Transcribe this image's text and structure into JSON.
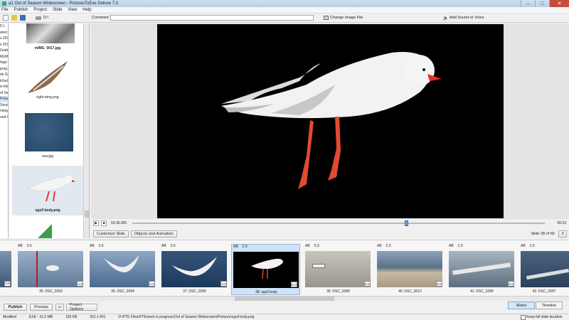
{
  "window": {
    "title": "a1 Out of Season Widescreen - PicturesToExe Deluxe 7.0"
  },
  "menu": [
    "File",
    "Publish",
    "Project",
    "Slide",
    "View",
    "Help"
  ],
  "toolbar": {
    "drive": "D:\\",
    "comment_label": "Comment",
    "change_image": "Change Image File",
    "add_sound": "Add Sound or Voice"
  },
  "tree": {
    "items": [
      "D:)",
      "",
      "",
      "",
      "",
      "",
      "",
      "",
      "",
      "eted s",
      "s 201",
      "s 201",
      "Grabb",
      "ttGM",
      "4apr",
      "prog",
      "ds Ge",
      "tchutz",
      "w fold",
      "of Se",
      "Pictu",
      "Soun",
      "nslay",
      "oud G"
    ]
  },
  "files": [
    {
      "name": "mIMG_0017.jpg"
    },
    {
      "name": "right wing.png"
    },
    {
      "name": "sea.jpg"
    },
    {
      "name": "sgull body.png"
    }
  ],
  "player": {
    "time_elapsed": "03:36.000",
    "time_total": "06:23",
    "position": 0.66
  },
  "options": {
    "customize_slide": "Customize Slide",
    "objects_animation": "Objects and Animation",
    "slide_count": "Slide 38 of 65",
    "close_x": "X"
  },
  "slides": [
    {
      "ab": "AB",
      "time": "3.5",
      "label": "35. DSC_0393",
      "dur": "4.0"
    },
    {
      "ab": "AB",
      "time": "3.5",
      "label": "36. DSC_0394",
      "dur": "4.0"
    },
    {
      "ab": "AB",
      "time": "3.5",
      "label": "37. DSC_0395",
      "dur": "4.0"
    },
    {
      "ab": "AB",
      "time": "2.0",
      "label": "38. sgull body",
      "dur": "8.0"
    },
    {
      "ab": "AB",
      "time": "5.0",
      "label": "39. DSC_0389",
      "dur": "6.5"
    },
    {
      "ab": "AB",
      "time": "2.0",
      "label": "40. DSC_0012",
      "dur": "6.5"
    },
    {
      "ab": "AB",
      "time": "2.0",
      "label": "41. DSC_0390",
      "dur": "6.5"
    },
    {
      "ab": "AB",
      "time": "2.0",
      "label": "42. DSC_0397",
      "dur": ""
    }
  ],
  "bottom": {
    "publish": "Publish",
    "preview": "Preview",
    "project_options": "Project Options",
    "slides_tab": "Slides",
    "timeline_tab": "Timeline"
  },
  "status": {
    "state": "Modified",
    "exe_size": "EXE - 31.0 MB",
    "file_kb": "159 KB",
    "dims": "501 x 401",
    "path": "D:\\PTE Files\\PTE\\work in progress\\Out of Season Widescreen\\Pictures\\sgull body.png",
    "keep_full": "Keep full slide duration"
  }
}
